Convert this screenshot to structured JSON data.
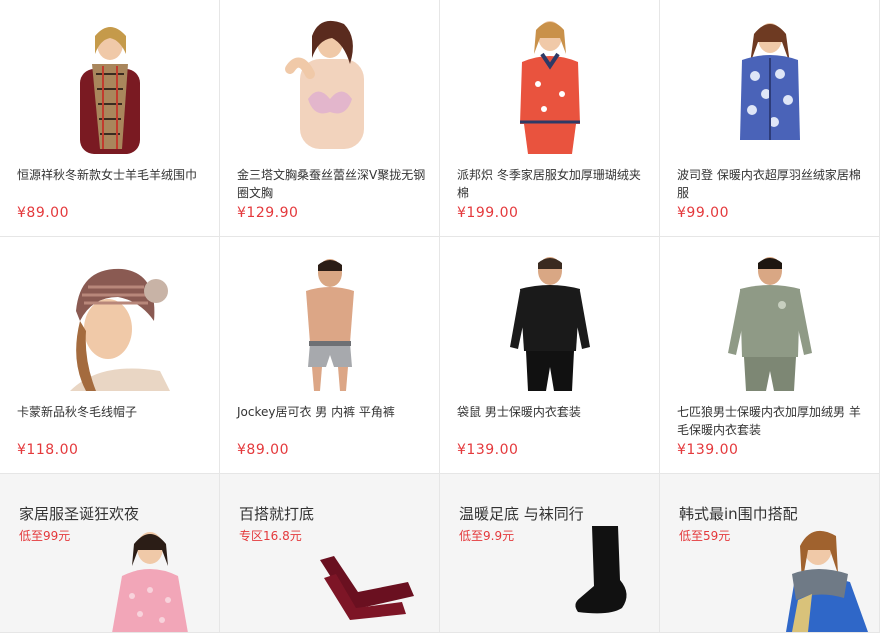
{
  "products": [
    {
      "name": "恒源祥秋冬新款女士羊毛羊绒围巾",
      "price": "¥89.00"
    },
    {
      "name": "金三塔文胸桑蚕丝蕾丝深V聚拢无钢圈文胸",
      "price": "¥129.90"
    },
    {
      "name": "派邦炽 冬季家居服女加厚珊瑚绒夹棉",
      "price": "¥199.00"
    },
    {
      "name": "波司登 保暖内衣超厚羽丝绒家居棉服",
      "price": "¥99.00"
    },
    {
      "name": "卡蒙新品秋冬毛线帽子",
      "price": "¥118.00"
    },
    {
      "name": "Jockey居可衣 男 内裤 平角裤",
      "price": "¥89.00"
    },
    {
      "name": "袋鼠 男士保暖内衣套装",
      "price": "¥139.00"
    },
    {
      "name": "七匹狼男士保暖内衣加厚加绒男 羊毛保暖内衣套装",
      "price": "¥139.00"
    }
  ],
  "promos": [
    {
      "title": "家居服圣诞狂欢夜",
      "subtitle": "低至99元"
    },
    {
      "title": "百搭就打底",
      "subtitle": "专区16.8元"
    },
    {
      "title": "温暖足底 与袜同行",
      "subtitle": "低至9.9元"
    },
    {
      "title": "韩式最in围巾搭配",
      "subtitle": "低至59元"
    }
  ],
  "colors": {
    "price": "#e4393c",
    "border": "#e6e6e6",
    "promo_bg": "#f5f5f5"
  }
}
